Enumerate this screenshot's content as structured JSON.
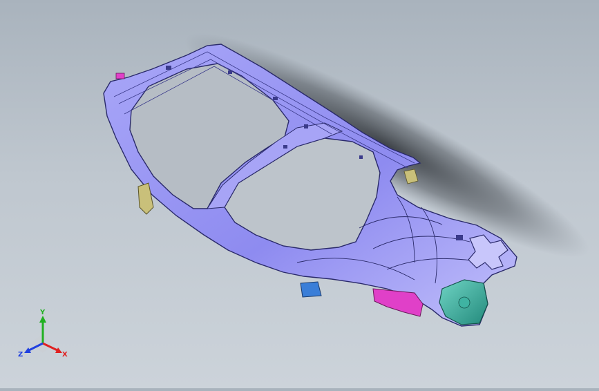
{
  "viewport": {
    "background_top": "#a9b3bd",
    "background_bottom": "#ccd3da",
    "model_color": "#8f8cf0",
    "model_edge_color": "#2a2a6a",
    "accent_magenta": "#e040c8",
    "accent_teal": "#3aa89a",
    "accent_blue": "#3a7ed8",
    "accent_olive": "#b0a858"
  },
  "triad": {
    "x_label": "X",
    "y_label": "Y",
    "z_label": "Z",
    "x_color": "#e02020",
    "y_color": "#20b020",
    "z_color": "#2040e0"
  }
}
